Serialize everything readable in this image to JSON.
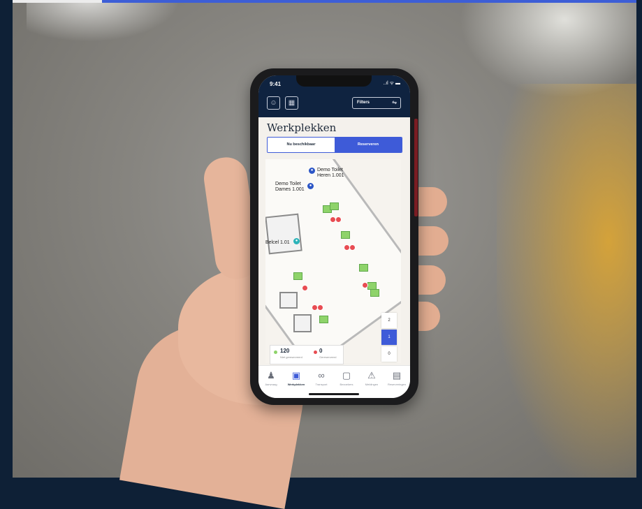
{
  "status_bar": {
    "time": "9:41",
    "icons": "..ıl ᯤ ▬"
  },
  "header": {
    "profile_icon": "person-icon",
    "building_icon": "building-icon",
    "filters_label": "Filters",
    "filters_icon": "sliders-icon"
  },
  "page": {
    "title": "Werkplekken"
  },
  "segments": {
    "left": "Nu beschikbaar",
    "right": "Reserveren",
    "active": "Reserveren"
  },
  "map": {
    "labels": {
      "toilet_heren": "Demo Toilet\nHeren 1.001",
      "toilet_dames": "Demo Toilet\nDames 1.001",
      "belcel": "Belcel 1.01"
    }
  },
  "floors": {
    "items": [
      "2",
      "1",
      "0"
    ],
    "active": "1"
  },
  "legend": {
    "available_count": "120",
    "available_label": "Niet gereserveerd",
    "reserved_count": "0",
    "reserved_label": "Gereserveerd",
    "colors": {
      "available": "#8ed36a",
      "reserved": "#e84c52"
    }
  },
  "tabbar": {
    "items": [
      {
        "label": "Aanvraag",
        "icon": "people-icon"
      },
      {
        "label": "Werkplekken",
        "icon": "desk-icon"
      },
      {
        "label": "Transport",
        "icon": "bike-icon"
      },
      {
        "label": "Bezoekers",
        "icon": "badge-icon"
      },
      {
        "label": "Meldingen",
        "icon": "warning-icon"
      },
      {
        "label": "Reserveringen",
        "icon": "calendar-icon"
      }
    ],
    "active": "Werkplekken"
  },
  "colors": {
    "header_bg": "#0f2340",
    "accent": "#3e5bd8"
  }
}
